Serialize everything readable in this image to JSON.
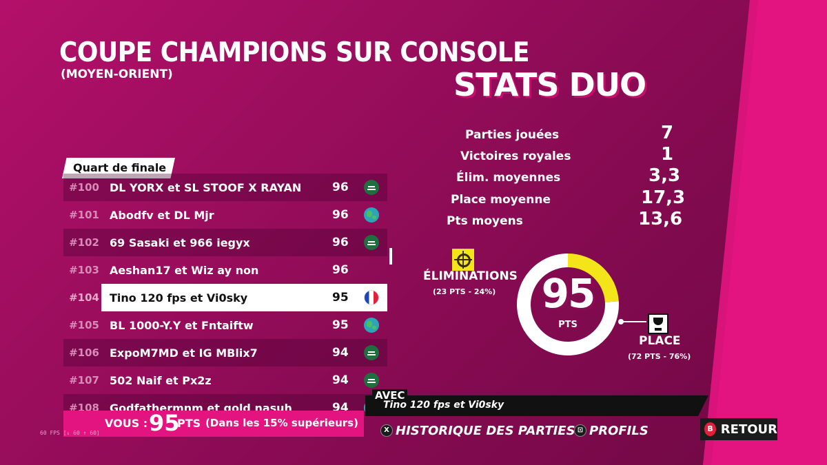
{
  "header": {
    "title": "COUPE CHAMPIONS SUR CONSOLE",
    "subtitle": "(MOYEN-ORIENT)"
  },
  "stats": {
    "title": "STATS DUO",
    "items": [
      {
        "label": "Parties jouées",
        "value": "7"
      },
      {
        "label": "Victoires royales",
        "value": "1"
      },
      {
        "label": "Élim. moyennes",
        "value": "3,3"
      },
      {
        "label": "Place moyenne",
        "value": "17,3"
      },
      {
        "label": "Pts moyens",
        "value": "13,6"
      }
    ]
  },
  "leaderboard": {
    "tab_label": "Quart de finale",
    "rows": [
      {
        "rank": "#100",
        "name": "DL YORX et SL STOOF X RAYAN",
        "pts": "96",
        "flag": "saudi-arabia-flag-icon"
      },
      {
        "rank": "#101",
        "name": "Abodfv et DL Mjr",
        "pts": "96",
        "flag": "globe-icon"
      },
      {
        "rank": "#102",
        "name": "69 Sasaki et 966 iegyx",
        "pts": "96",
        "flag": "saudi-arabia-flag-icon"
      },
      {
        "rank": "#103",
        "name": "Aeshan17 et Wiz ay non",
        "pts": "96",
        "flag": ""
      },
      {
        "rank": "#104",
        "name": "Tino 120 fps et Vi0sky",
        "pts": "95",
        "flag": "france-flag-icon",
        "selected": true
      },
      {
        "rank": "#105",
        "name": "BL 1000-Y.Y et Fntaiftw",
        "pts": "95",
        "flag": "globe-icon"
      },
      {
        "rank": "#106",
        "name": "ExpoM7MD et IG MBlix7",
        "pts": "94",
        "flag": "saudi-arabia-flag-icon"
      },
      {
        "rank": "#107",
        "name": "502 Naif et Px2z",
        "pts": "94",
        "flag": "saudi-arabia-flag-icon"
      },
      {
        "rank": "#108",
        "name": "Godfathermnm et gold nasuh",
        "pts": "94",
        "flag": "globe-icon"
      }
    ]
  },
  "you": {
    "label": "VOUS :",
    "points": "95",
    "unit": "PTS",
    "note": "(Dans les 15% supérieurs)"
  },
  "fps_readout": "60 FPS [↓ 60 ↑ 60]",
  "score_ring": {
    "total": "95",
    "unit": "PTS",
    "eliminations_fraction": 0.24,
    "place_fraction": 0.76,
    "eliminations_color": "#f4e51a",
    "place_color": "#ffffff",
    "eliminations_label": "ÉLIMINATIONS",
    "eliminations_sub": "(23 PTS - 24%)",
    "place_label": "PLACE",
    "place_sub": "(72 PTS - 76%)"
  },
  "teammate": {
    "label": "AVEC",
    "name": "Tino 120 fps et Vi0sky"
  },
  "buttons": {
    "history": {
      "glyph": "X",
      "label": "HISTORIQUE DES PARTIES"
    },
    "profiles": {
      "glyph": "⊡",
      "label": "PROFILS"
    },
    "back": {
      "glyph": "B",
      "label": "RETOUR"
    }
  },
  "colors": {
    "background": "#e3137f",
    "panel": "#8a0b54",
    "accent_yellow": "#f4e51a"
  }
}
